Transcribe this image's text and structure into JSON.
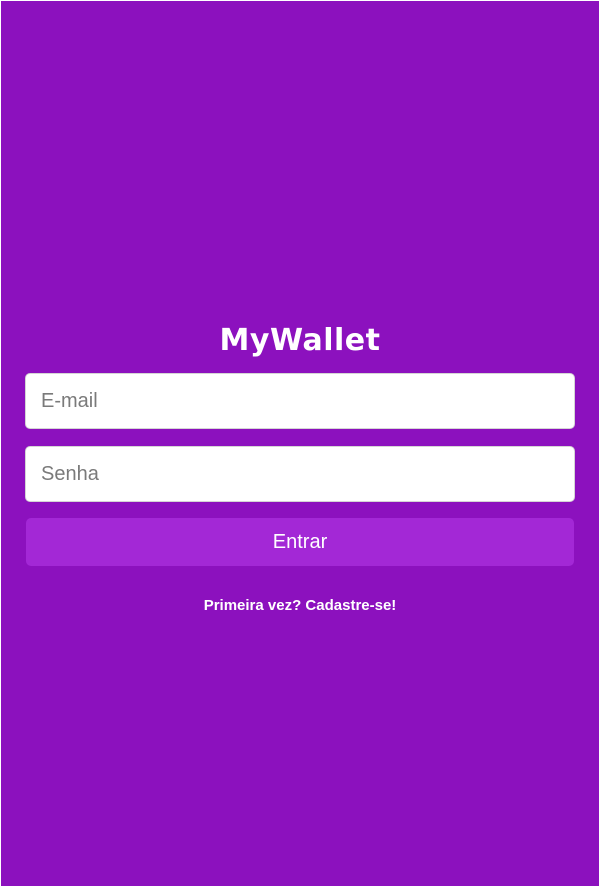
{
  "app": {
    "logo_text": "MyWallet"
  },
  "login_form": {
    "email_placeholder": "E-mail",
    "email_value": "",
    "password_placeholder": "Senha",
    "password_value": "",
    "submit_label": "Entrar",
    "signup_link_label": "Primeira vez? Cadastre-se!"
  },
  "colors": {
    "background": "#8c11be",
    "button": "#a328d6",
    "input_background": "#ffffff",
    "text": "#ffffff"
  }
}
